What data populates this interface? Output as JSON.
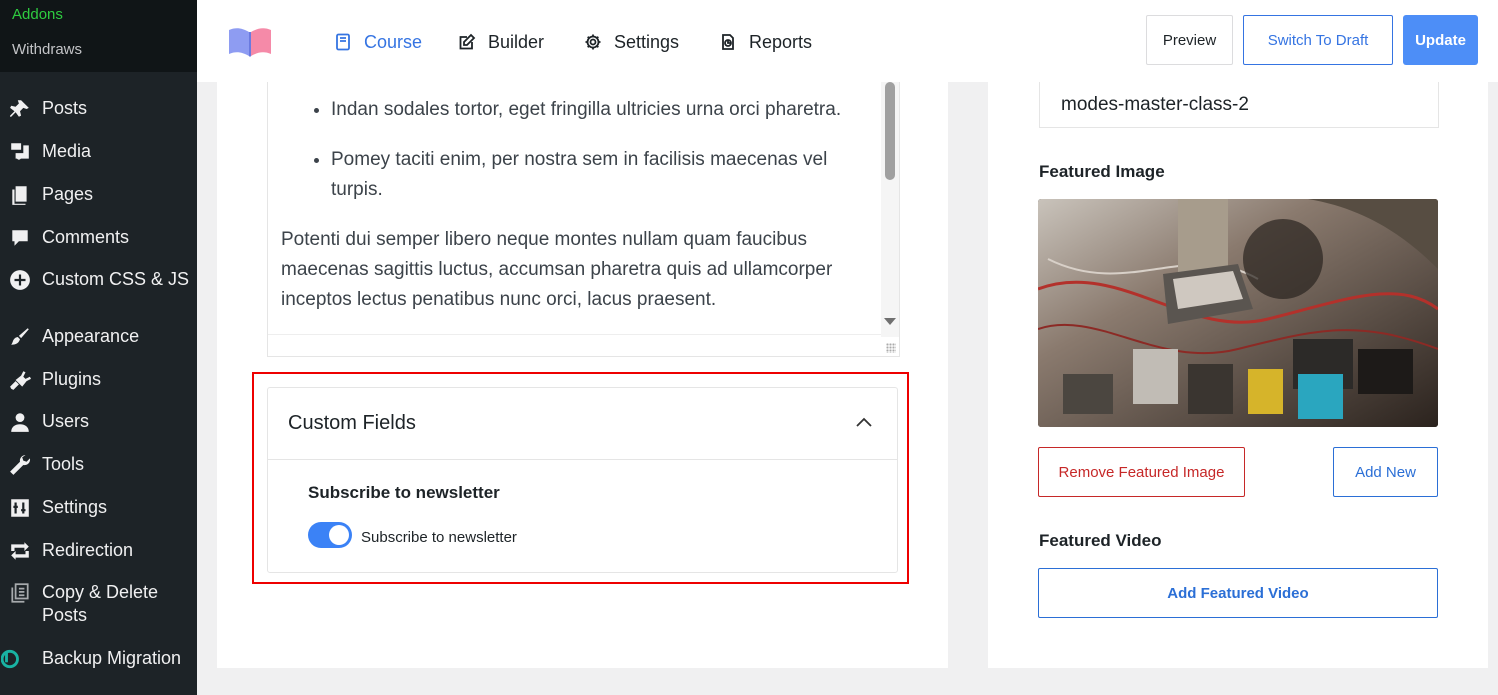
{
  "sidebar": {
    "submenu": [
      {
        "label": "Addons",
        "color": "#2ecc40"
      },
      {
        "label": "Withdraws"
      }
    ],
    "items": [
      {
        "label": "Posts",
        "icon": "pin-icon"
      },
      {
        "label": "Media",
        "icon": "media-icon"
      },
      {
        "label": "Pages",
        "icon": "pages-icon"
      },
      {
        "label": "Comments",
        "icon": "comment-icon"
      },
      {
        "label": "Custom CSS & JS",
        "icon": "plus-circle-icon"
      },
      {
        "label": "Appearance",
        "icon": "brush-icon"
      },
      {
        "label": "Plugins",
        "icon": "plug-icon"
      },
      {
        "label": "Users",
        "icon": "user-icon"
      },
      {
        "label": "Tools",
        "icon": "wrench-icon"
      },
      {
        "label": "Settings",
        "icon": "sliders-icon"
      },
      {
        "label": "Redirection",
        "icon": "arrows-icon"
      },
      {
        "label": "Copy & Delete Posts",
        "icon": "copy-icon"
      },
      {
        "label": "Backup Migration",
        "icon": "backup-icon"
      }
    ]
  },
  "topbar": {
    "tabs": [
      {
        "label": "Course",
        "icon": "book-icon",
        "active": true
      },
      {
        "label": "Builder",
        "icon": "edit-icon"
      },
      {
        "label": "Settings",
        "icon": "gear-icon"
      },
      {
        "label": "Reports",
        "icon": "report-icon"
      }
    ],
    "preview_label": "Preview",
    "draft_label": "Switch To Draft",
    "update_label": "Update",
    "accent_color": "#3574e2"
  },
  "editor": {
    "bullets": [
      "Indan sodales tortor, eget fringilla ultricies urna orci pharetra.",
      "Pomey taciti enim, per nostra sem in facilisis maecenas vel turpis."
    ],
    "paragraph": "Potenti dui semper libero neque montes nullam quam faucibus maecenas sagittis luctus, accumsan pharetra quis ad ullamcorper inceptos lectus penatibus nunc orci, lacus praesent."
  },
  "custom_fields": {
    "title": "Custom Fields",
    "field_label": "Subscribe to newsletter",
    "toggle_label": "Subscribe to newsletter",
    "toggle_on": true,
    "highlight_color": "#e00000"
  },
  "side": {
    "slug": "modes-master-class-2",
    "featured_image_heading": "Featured Image",
    "remove_image_label": "Remove Featured Image",
    "add_new_label": "Add New",
    "featured_video_heading": "Featured Video",
    "add_video_label": "Add Featured Video"
  }
}
